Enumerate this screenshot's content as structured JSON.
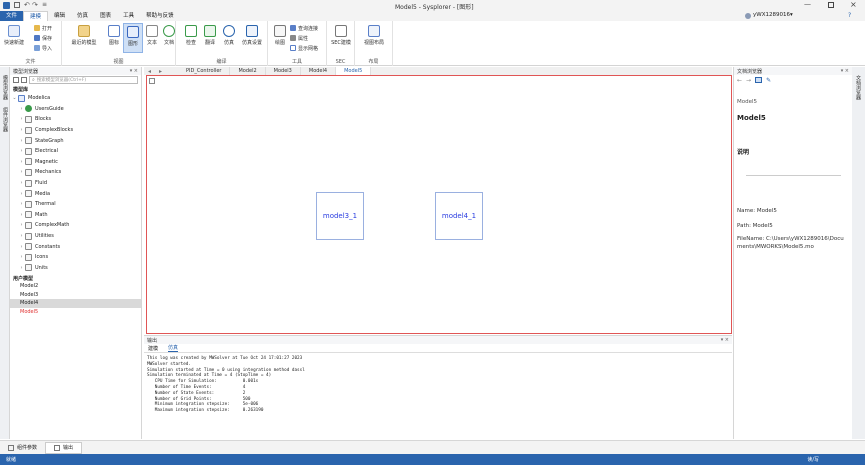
{
  "window": {
    "title": "Model5 - Sysplorer - [图形]",
    "user": "yWX1289016",
    "user_suffix": "▾"
  },
  "menu": [
    "文件",
    "建模",
    "编辑",
    "仿真",
    "图表",
    "工具",
    "帮助与反馈"
  ],
  "ribbon": {
    "new_model": "快速新建",
    "open": "打开",
    "save": "保存",
    "import": "导入",
    "group_file": "文件",
    "recent": "最近的模型",
    "icon_view": "图标",
    "diagram_view": "图形",
    "text_view": "文本",
    "doc_view": "文档",
    "group_view": "视图",
    "check": "检查",
    "translate": "翻译",
    "simulate": "仿真",
    "sim_settings": "仿真设置",
    "group_compile": "编译",
    "draw": "绘图",
    "query_connect": "查询连接",
    "properties": "属性",
    "show_grid": "显示网格",
    "group_tools": "工具",
    "ssc_modeling": "SEC建模",
    "group_sec": "SEC",
    "view_layout": "视图布局",
    "group_layout": "布局"
  },
  "left_panel": {
    "title": "模型浏览器",
    "search_placeholder": "搜索模型浏览器(Ctrl+F)",
    "lib_header": "模型库",
    "root": "Modelica",
    "libs": [
      "UsersGuide",
      "Blocks",
      "ComplexBlocks",
      "StateGraph",
      "Electrical",
      "Magnetic",
      "Mechanics",
      "Fluid",
      "Media",
      "Thermal",
      "Math",
      "ComplexMath",
      "Utilities",
      "Constants",
      "Icons",
      "Units"
    ],
    "user_header": "用户模型",
    "user_models": [
      "Model2",
      "Model3",
      "Model4",
      "Model5"
    ],
    "strip_labels": [
      "模型浏览器",
      "组件浏览器"
    ]
  },
  "doc_tabs": [
    "PID_Controller",
    "Model2",
    "Model3",
    "Model4",
    "Model5"
  ],
  "canvas": {
    "blocks": [
      {
        "label": "model3_1"
      },
      {
        "label": "model4_1"
      }
    ]
  },
  "output": {
    "title": "输出",
    "tabs": [
      "建模",
      "仿真"
    ],
    "log": [
      "This log was created by MWSolver at Tue Oct 24 17:01:27 2023",
      "MWSolver started.",
      "Simulation started at Time = 0 using integration method dassl",
      "Simulation terminated at Time = 4 (StopTime = 4)",
      "   CPU Time for Simulation:          0.001s",
      "   Number of Time Events:            4",
      "   Number of State Events:           2",
      "   Number of Grid Points:            500",
      "   Minimum integration stepsize:     5e-006",
      "   Maximum integration stepsize:     0.263190"
    ]
  },
  "right_panel": {
    "title": "文档浏览器",
    "breadcrumb": "Model5",
    "heading": "Model5",
    "desc_header": "说明",
    "name_line": "Name: Model5",
    "path_line": "Path: Model5",
    "file_line": "FileName: C:\\Users\\yWX1289016\\Documents\\MWORKS\\Model5.mo",
    "strip_label": "文档浏览器"
  },
  "bottom_tabs": [
    "组件参数",
    "输出"
  ],
  "status": {
    "left": "就绪",
    "right": "读/写"
  },
  "colors": {
    "accent": "#2a64ad",
    "canvas_border": "#e05555",
    "block_text": "#2a3de0",
    "user_model_active": "#e03030"
  }
}
